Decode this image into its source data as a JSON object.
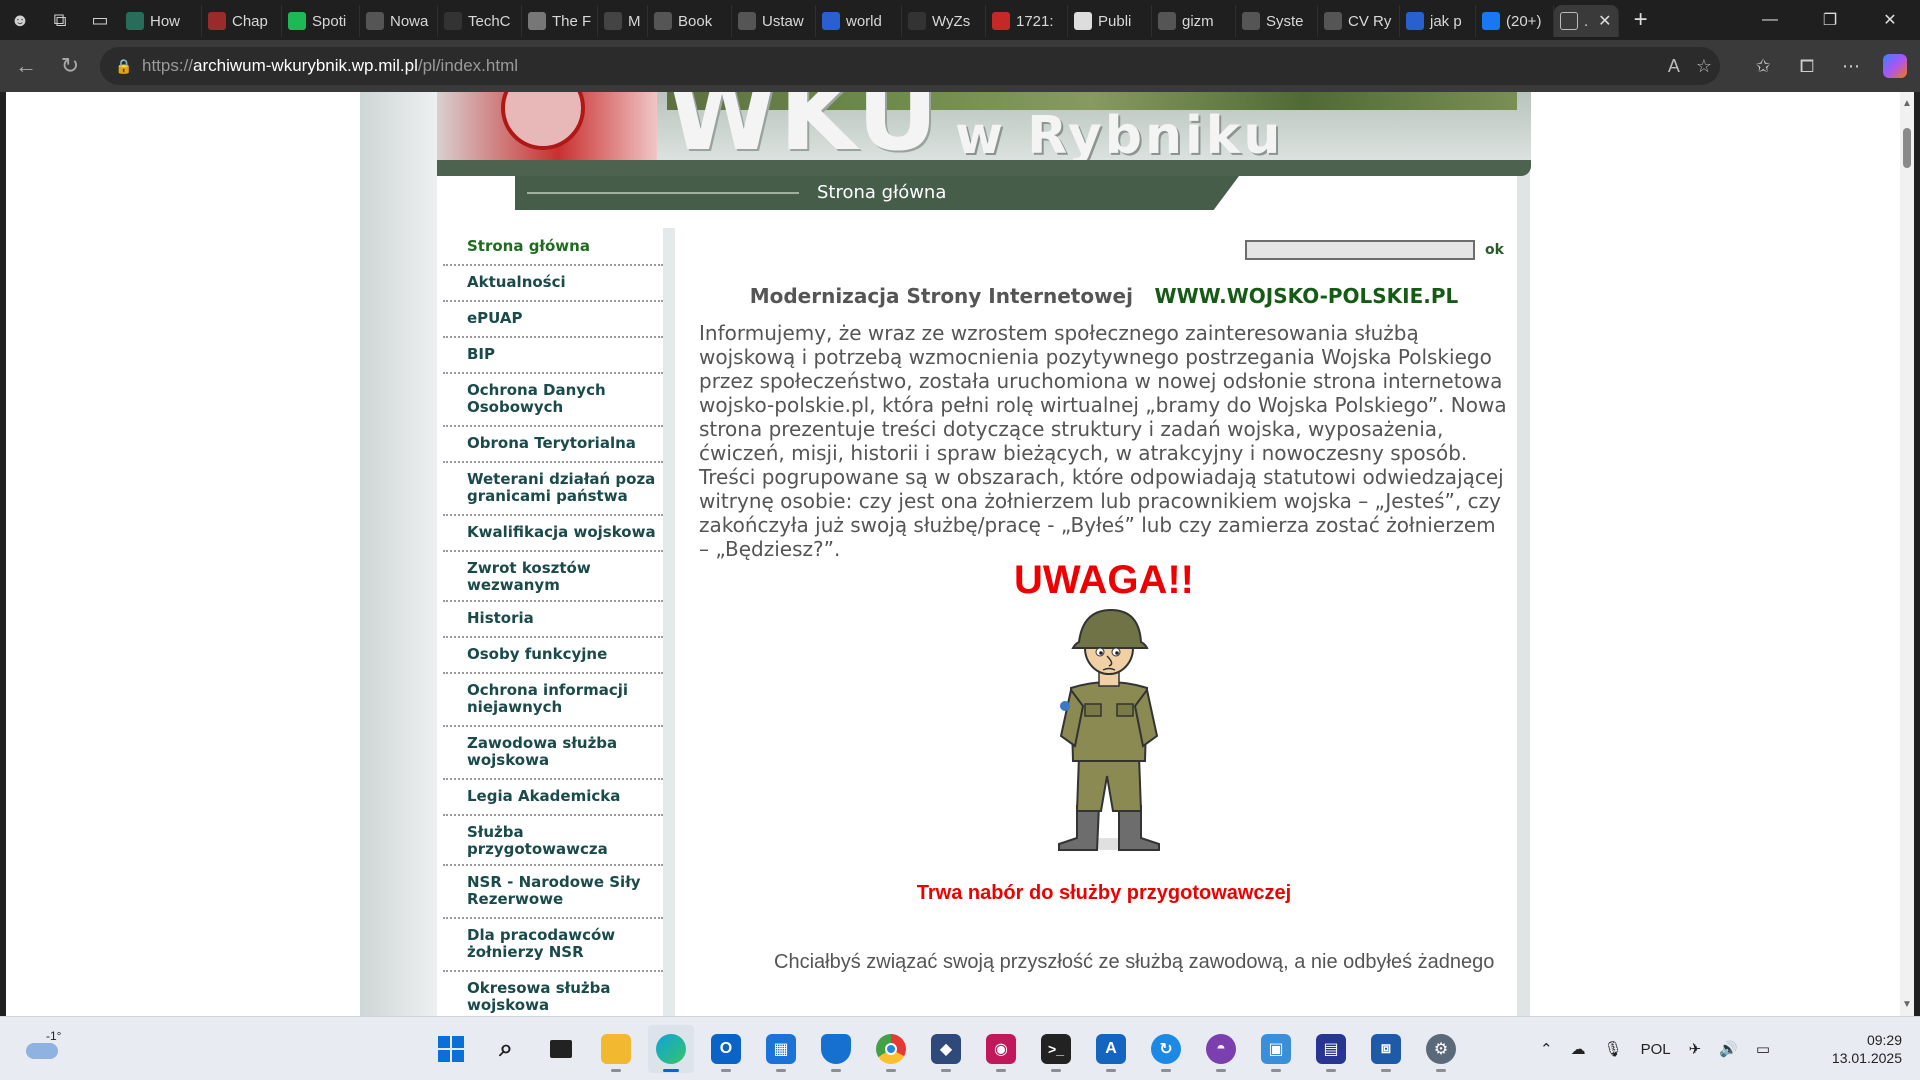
{
  "browser": {
    "tabs": [
      {
        "label": "How",
        "color": "#2a6c5a"
      },
      {
        "label": "Chap",
        "color": "#9b2a2a"
      },
      {
        "label": "Spoti",
        "color": "#1db954"
      },
      {
        "label": "Nowa",
        "color": "#555555"
      },
      {
        "label": "TechC",
        "color": "#333333"
      },
      {
        "label": "The F",
        "color": "#777777"
      },
      {
        "label": "M",
        "color": "#444444"
      },
      {
        "label": "Book",
        "color": "#555555"
      },
      {
        "label": "Ustaw",
        "color": "#555555"
      },
      {
        "label": "world",
        "color": "#2a5fd0"
      },
      {
        "label": "WyZs",
        "color": "#333333"
      },
      {
        "label": "1721:",
        "color": "#c62828"
      },
      {
        "label": "Publi",
        "color": "#dddddd"
      },
      {
        "label": "gizm",
        "color": "#555555"
      },
      {
        "label": "Syste",
        "color": "#555555"
      },
      {
        "label": "CV Ry",
        "color": "#555555"
      },
      {
        "label": "jak p",
        "color": "#2a5fd0"
      },
      {
        "label": "(20+)",
        "color": "#1877f2"
      }
    ],
    "active_tab_label": ".",
    "url_prefix": "https://",
    "url_host": "archiwum-wkurybnik.wp.mil.pl",
    "url_path": "/pl/index.html"
  },
  "site": {
    "banner_title": "WKU",
    "banner_subtitle": "w Rybniku",
    "page_title": "Strona główna"
  },
  "menu": [
    {
      "label": "Strona główna"
    },
    {
      "label": "Aktualności"
    },
    {
      "label": "ePUAP"
    },
    {
      "label": "BIP"
    },
    {
      "label": "Ochrona Danych Osobowych"
    },
    {
      "label": "Obrona Terytorialna"
    },
    {
      "label": "Weterani działań poza granicami państwa"
    },
    {
      "label": "Kwalifikacja wojskowa"
    },
    {
      "label": "Zwrot kosztów wezwanym"
    },
    {
      "label": "Historia"
    },
    {
      "label": "Osoby funkcyjne"
    },
    {
      "label": "Ochrona informacji niejawnych"
    },
    {
      "label": "Zawodowa służba wojskowa"
    },
    {
      "label": "Legia Akademicka"
    },
    {
      "label": "Służba przygotowawcza"
    },
    {
      "label": "NSR - Narodowe Siły Rezerwowe"
    },
    {
      "label": "Dla pracodawców żołnierzy NSR"
    },
    {
      "label": "Okresowa służba wojskowa"
    }
  ],
  "search": {
    "button": "ok",
    "value": ""
  },
  "content": {
    "headline_1": "Modernizacja Strony Internetowej",
    "headline_2": "WWW.WOJSKO-POLSKIE.PL",
    "intro": "Informujemy, że wraz ze wzrostem społecznego zainteresowania służbą wojskową i potrzebą wzmocnienia pozytywnego postrzegania Wojska Polskiego przez społeczeństwo, została uruchomiona w nowej odsłonie strona internetowa wojsko-polskie.pl, która pełni rolę wirtualnej „bramy do Wojska Polskiego”.  Nowa strona prezentuje treści dotyczące struktury i zadań wojska, wyposażenia, ćwiczeń, misji, historii i spraw bieżących, w atrakcyjny i nowoczesny sposób. Treści pogrupowane są w obszarach, które odpowiadają statutowi odwiedzającej witrynę osobie: czy jest ona żołnierzem lub pracownikiem wojska – „Jesteś”, czy zakończyła już swoją służbę/pracę  - „Byłeś” lub czy zamierza zostać żołnierzem – „Będziesz?”.",
    "alert": "UWAGA!!",
    "recruitment": "Trwa nabór do służby przygotowawczej",
    "more": "Chciałbyś związać swoją przyszłość ze służbą zawodową, a nie odbyłeś żadnego"
  },
  "taskbar": {
    "weather_temp": "-1°",
    "language": "POL",
    "time": "09:29",
    "date": "13.01.2025"
  }
}
